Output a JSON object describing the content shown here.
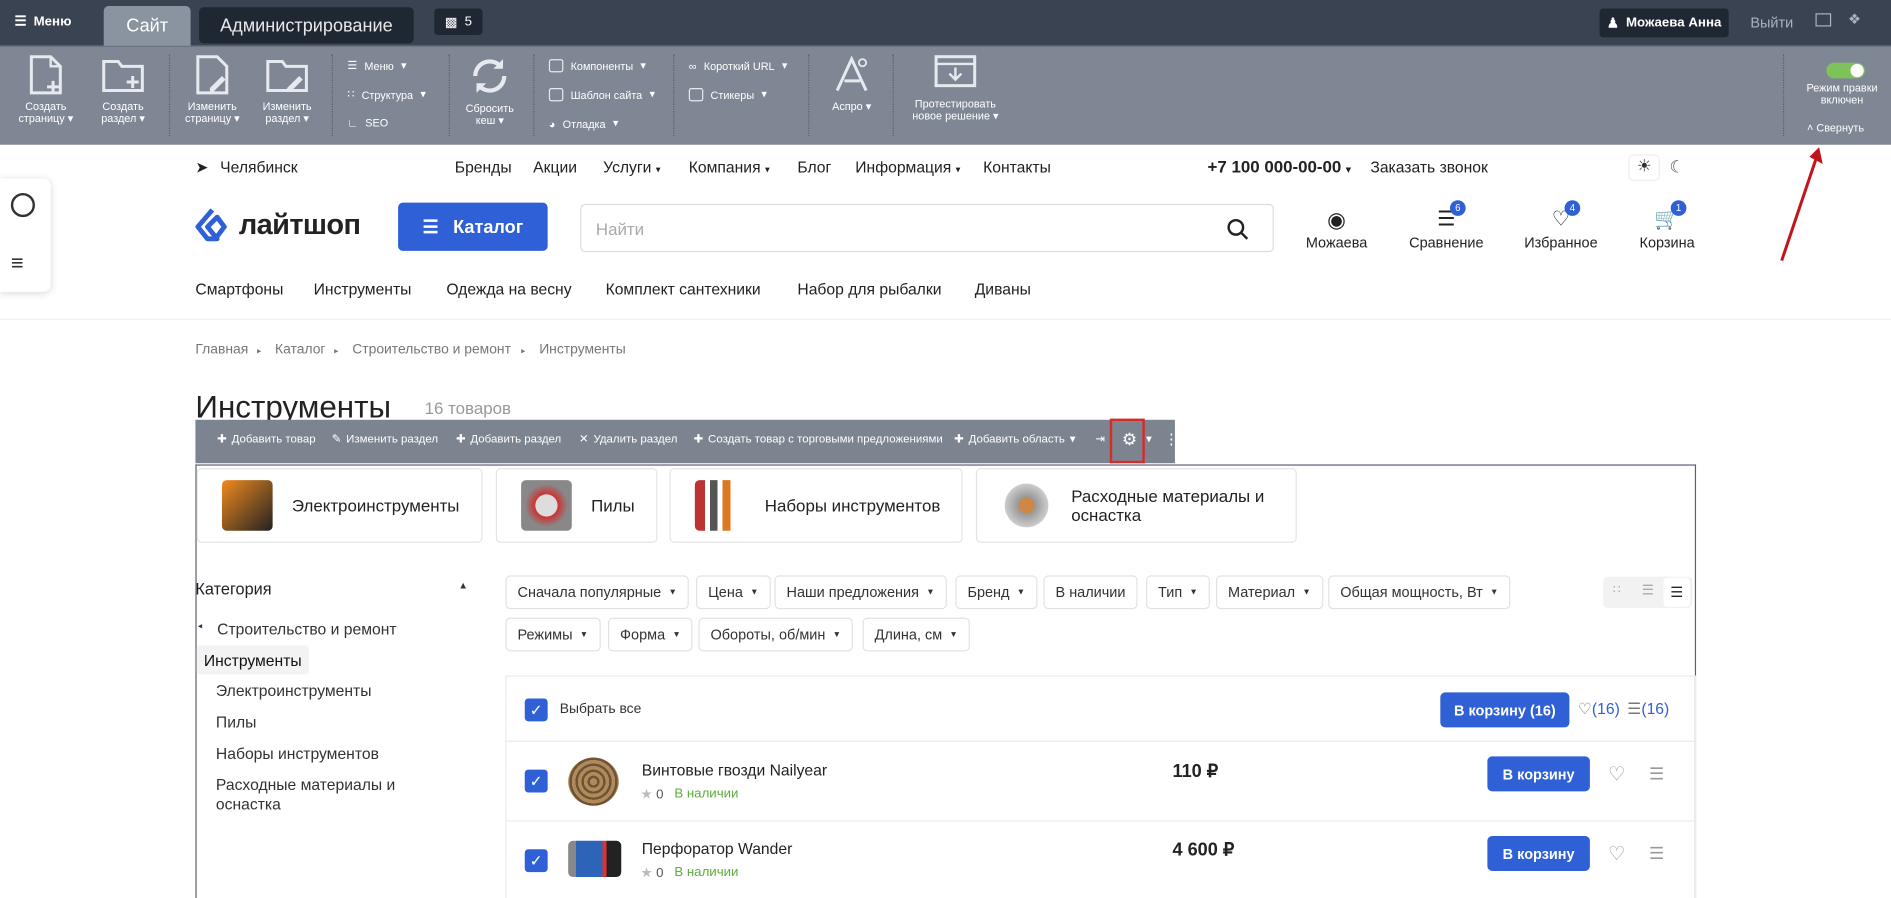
{
  "admin_bar": {
    "menu_label": "Меню",
    "tab_site": "Сайт",
    "tab_admin": "Администрирование",
    "notifications": "5",
    "user": "Можаева Анна",
    "logout": "Выйти"
  },
  "admin_panel": {
    "buttons": [
      "Создать страницу",
      "Создать раздел",
      "Изменить страницу",
      "Изменить раздел",
      "Сбросить кеш",
      "Аспро",
      "Протестировать новое решение"
    ],
    "col1": [
      "Меню",
      "Структура",
      "SEO"
    ],
    "col2": [
      "Компоненты",
      "Шаблон сайта",
      "Отладка"
    ],
    "col3": [
      "Короткий URL",
      "Стикеры"
    ],
    "edit_mode": "Режим правки включен",
    "collapse": "Свернуть"
  },
  "header": {
    "city": "Челябинск",
    "nav": [
      "Бренды",
      "Акции",
      "Услуги",
      "Компания",
      "Блог",
      "Информация",
      "Контакты"
    ],
    "phone": "+7 100 000-00-00",
    "callback": "Заказать звонок",
    "logo": "лайтшоп",
    "catalog_btn": "Каталог",
    "search_placeholder": "Найти",
    "icons": [
      {
        "label": "Можаева",
        "badge": ""
      },
      {
        "label": "Сравнение",
        "badge": "6"
      },
      {
        "label": "Избранное",
        "badge": "4"
      },
      {
        "label": "Корзина",
        "badge": "1"
      }
    ],
    "quick_links": [
      "Смартфоны",
      "Инструменты",
      "Одежда на весну",
      "Комплект сантехники",
      "Набор для рыбалки",
      "Диваны"
    ]
  },
  "breadcrumbs": [
    "Главная",
    "Каталог",
    "Строительство и ремонт",
    "Инструменты"
  ],
  "page": {
    "title": "Инструменты",
    "count": "16 товаров"
  },
  "edit_toolbar": [
    "Добавить товар",
    "Изменить раздел",
    "Добавить раздел",
    "Удалить раздел",
    "Создать товар с торговыми предложениями",
    "Добавить область"
  ],
  "subsections": [
    "Электроинструменты",
    "Пилы",
    "Наборы инструментов",
    "Расходные материалы и оснастка"
  ],
  "sidebar": {
    "heading": "Категория",
    "parent": "Строительство и ремонт",
    "current": "Инструменты",
    "children": [
      "Электроинструменты",
      "Пилы",
      "Наборы инструментов",
      "Расходные материалы и оснастка"
    ]
  },
  "filters": {
    "row1": [
      "Сначала популярные",
      "Цена",
      "Наши предложения",
      "Бренд",
      "В наличии",
      "Тип",
      "Материал",
      "Общая мощность, Вт"
    ],
    "row2": [
      "Режимы",
      "Форма",
      "Обороты, об/мин",
      "Длина, см"
    ]
  },
  "list": {
    "select_all": "Выбрать все",
    "to_cart_all": "В корзину",
    "to_cart_all_count": "(16)",
    "fav_count": "(16)",
    "cmp_count": "(16)",
    "products": [
      {
        "name": "Винтовые гвозди Nailyear",
        "price": "110 ₽",
        "rating": "0",
        "stock": "В наличии",
        "btn": "В корзину"
      },
      {
        "name": "Перфоратор Wander",
        "price": "4 600 ₽",
        "rating": "0",
        "stock": "В наличии",
        "btn": "В корзину"
      }
    ]
  },
  "colors": {
    "accent": "#3060d6",
    "admin_dark": "#3a4351",
    "panel": "#7f8794",
    "stock": "#5cad3c"
  }
}
